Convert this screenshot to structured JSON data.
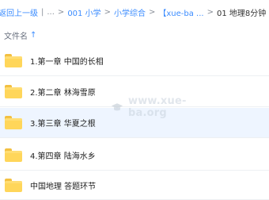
{
  "breadcrumb": {
    "up": "返回上一级",
    "ellipsis": "...",
    "items": [
      "001 小学",
      "小学综合",
      "【xue-ba ...",
      "01 地理8分钟"
    ]
  },
  "list_header": {
    "name_label": "文件名",
    "sort_icon": "arrow-up-icon"
  },
  "files": [
    {
      "name": "1.第一章 中国的长相",
      "icon": "folder-icon"
    },
    {
      "name": "2.第二章 林海雪原",
      "icon": "folder-icon"
    },
    {
      "name": "3.第三章 华夏之根",
      "icon": "folder-icon"
    },
    {
      "name": "4.第四章 陆海水乡",
      "icon": "folder-icon"
    },
    {
      "name": "中国地理 答题环节",
      "icon": "folder-icon"
    }
  ],
  "watermark": {
    "text": "www.xue-ba.org",
    "icon": "graduation-cap-icon"
  },
  "colors": {
    "link": "#3b8cff",
    "folder": "#ffd65a",
    "highlight_row": "#eef5ff"
  }
}
